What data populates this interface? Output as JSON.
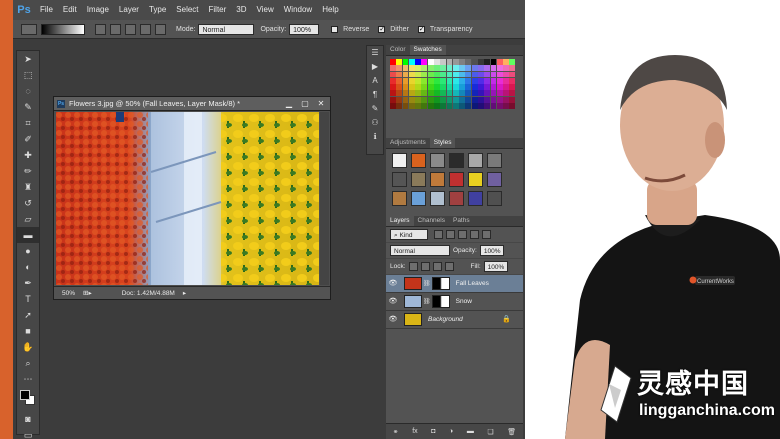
{
  "app": {
    "logo": "Ps",
    "menu": [
      "File",
      "Edit",
      "Image",
      "Layer",
      "Type",
      "Select",
      "Filter",
      "3D",
      "View",
      "Window",
      "Help"
    ]
  },
  "options_bar": {
    "mode_label": "Mode:",
    "mode_value": "Normal",
    "opacity_label": "Opacity:",
    "opacity_value": "100%",
    "reverse_label": "Reverse",
    "dither_label": "Dither",
    "transparency_label": "Transparency",
    "reverse_checked": false,
    "dither_checked": true,
    "transparency_checked": true
  },
  "document": {
    "title": "Flowers 3.jpg @ 50% (Fall Leaves, Layer Mask/8) *",
    "zoom": "50%",
    "doc_size": "Doc: 1.42M/4.88M",
    "ps_icon": "Ps"
  },
  "panels": {
    "color_tabs": [
      "Color",
      "Swatches"
    ],
    "active_color_tab": 1,
    "style_tabs": [
      "Adjustments",
      "Styles"
    ],
    "active_style_tab": 1,
    "layer_tabs": [
      "Layers",
      "Channels",
      "Paths"
    ],
    "active_layer_tab": 0,
    "kind_label": "Kind",
    "blend_mode": "Normal",
    "opacity_label": "Opacity:",
    "opacity_value": "100%",
    "lock_label": "Lock:",
    "fill_label": "Fill:",
    "fill_value": "100%",
    "layers": [
      {
        "name": "Fall Leaves",
        "selected": true,
        "has_mask": true,
        "italic": false,
        "thumb": "#c4341a"
      },
      {
        "name": "Snow",
        "selected": false,
        "has_mask": true,
        "italic": false,
        "thumb": "#9fb8d8"
      },
      {
        "name": "Background",
        "selected": false,
        "has_mask": false,
        "italic": true,
        "thumb": "#d9b516"
      }
    ]
  },
  "watermark": {
    "chinese": "灵感中国",
    "english": "lingganchina.com"
  },
  "presenter_shirt_logo": "CurrentWorks"
}
